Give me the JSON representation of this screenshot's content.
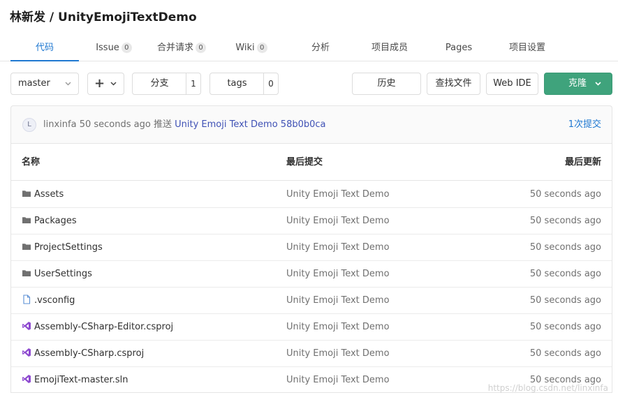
{
  "repo": {
    "owner": "林新发",
    "separator": " / ",
    "name": "UnityEmojiTextDemo"
  },
  "tabs": [
    {
      "label": "代码",
      "count": null
    },
    {
      "label": "Issue",
      "count": "0"
    },
    {
      "label": "合并请求",
      "count": "0"
    },
    {
      "label": "Wiki",
      "count": "0"
    },
    {
      "label": "分析",
      "count": null
    },
    {
      "label": "项目成员",
      "count": null
    },
    {
      "label": "Pages",
      "count": null
    },
    {
      "label": "项目设置",
      "count": null
    }
  ],
  "toolbar": {
    "branch": "master",
    "add_symbol": "+",
    "branches_label": "分支",
    "branches_count": "1",
    "tags_label": "tags",
    "tags_count": "0",
    "history": "历史",
    "find_file": "查找文件",
    "web_ide": "Web IDE",
    "clone": "克隆"
  },
  "commit": {
    "avatar_letter": "L",
    "author": "linxinfa",
    "time": "50 seconds ago",
    "action": "推送",
    "message": "Unity Emoji Text Demo",
    "sha": "58b0b0ca",
    "count_label": "1次提交"
  },
  "table": {
    "headers": {
      "name": "名称",
      "last_commit": "最后提交",
      "last_update": "最后更新"
    },
    "rows": [
      {
        "icon": "folder-icon",
        "name": "Assets",
        "commit": "Unity Emoji Text Demo",
        "time": "50 seconds ago"
      },
      {
        "icon": "folder-icon",
        "name": "Packages",
        "commit": "Unity Emoji Text Demo",
        "time": "50 seconds ago"
      },
      {
        "icon": "folder-icon",
        "name": "ProjectSettings",
        "commit": "Unity Emoji Text Demo",
        "time": "50 seconds ago"
      },
      {
        "icon": "folder-icon",
        "name": "UserSettings",
        "commit": "Unity Emoji Text Demo",
        "time": "50 seconds ago"
      },
      {
        "icon": "file-icon",
        "name": ".vsconfig",
        "commit": "Unity Emoji Text Demo",
        "time": "50 seconds ago"
      },
      {
        "icon": "visual-studio-icon",
        "name": "Assembly-CSharp-Editor.csproj",
        "commit": "Unity Emoji Text Demo",
        "time": "50 seconds ago"
      },
      {
        "icon": "visual-studio-icon",
        "name": "Assembly-CSharp.csproj",
        "commit": "Unity Emoji Text Demo",
        "time": "50 seconds ago"
      },
      {
        "icon": "visual-studio-icon",
        "name": "EmojiText-master.sln",
        "commit": "Unity Emoji Text Demo",
        "time": "50 seconds ago"
      }
    ]
  },
  "watermark": "https://blog.csdn.net/linxinfa",
  "colors": {
    "accent": "#1f78d1",
    "clone_button": "#3fa37c",
    "link": "#3f51b5",
    "vs_icon": "#8e4ad0"
  }
}
